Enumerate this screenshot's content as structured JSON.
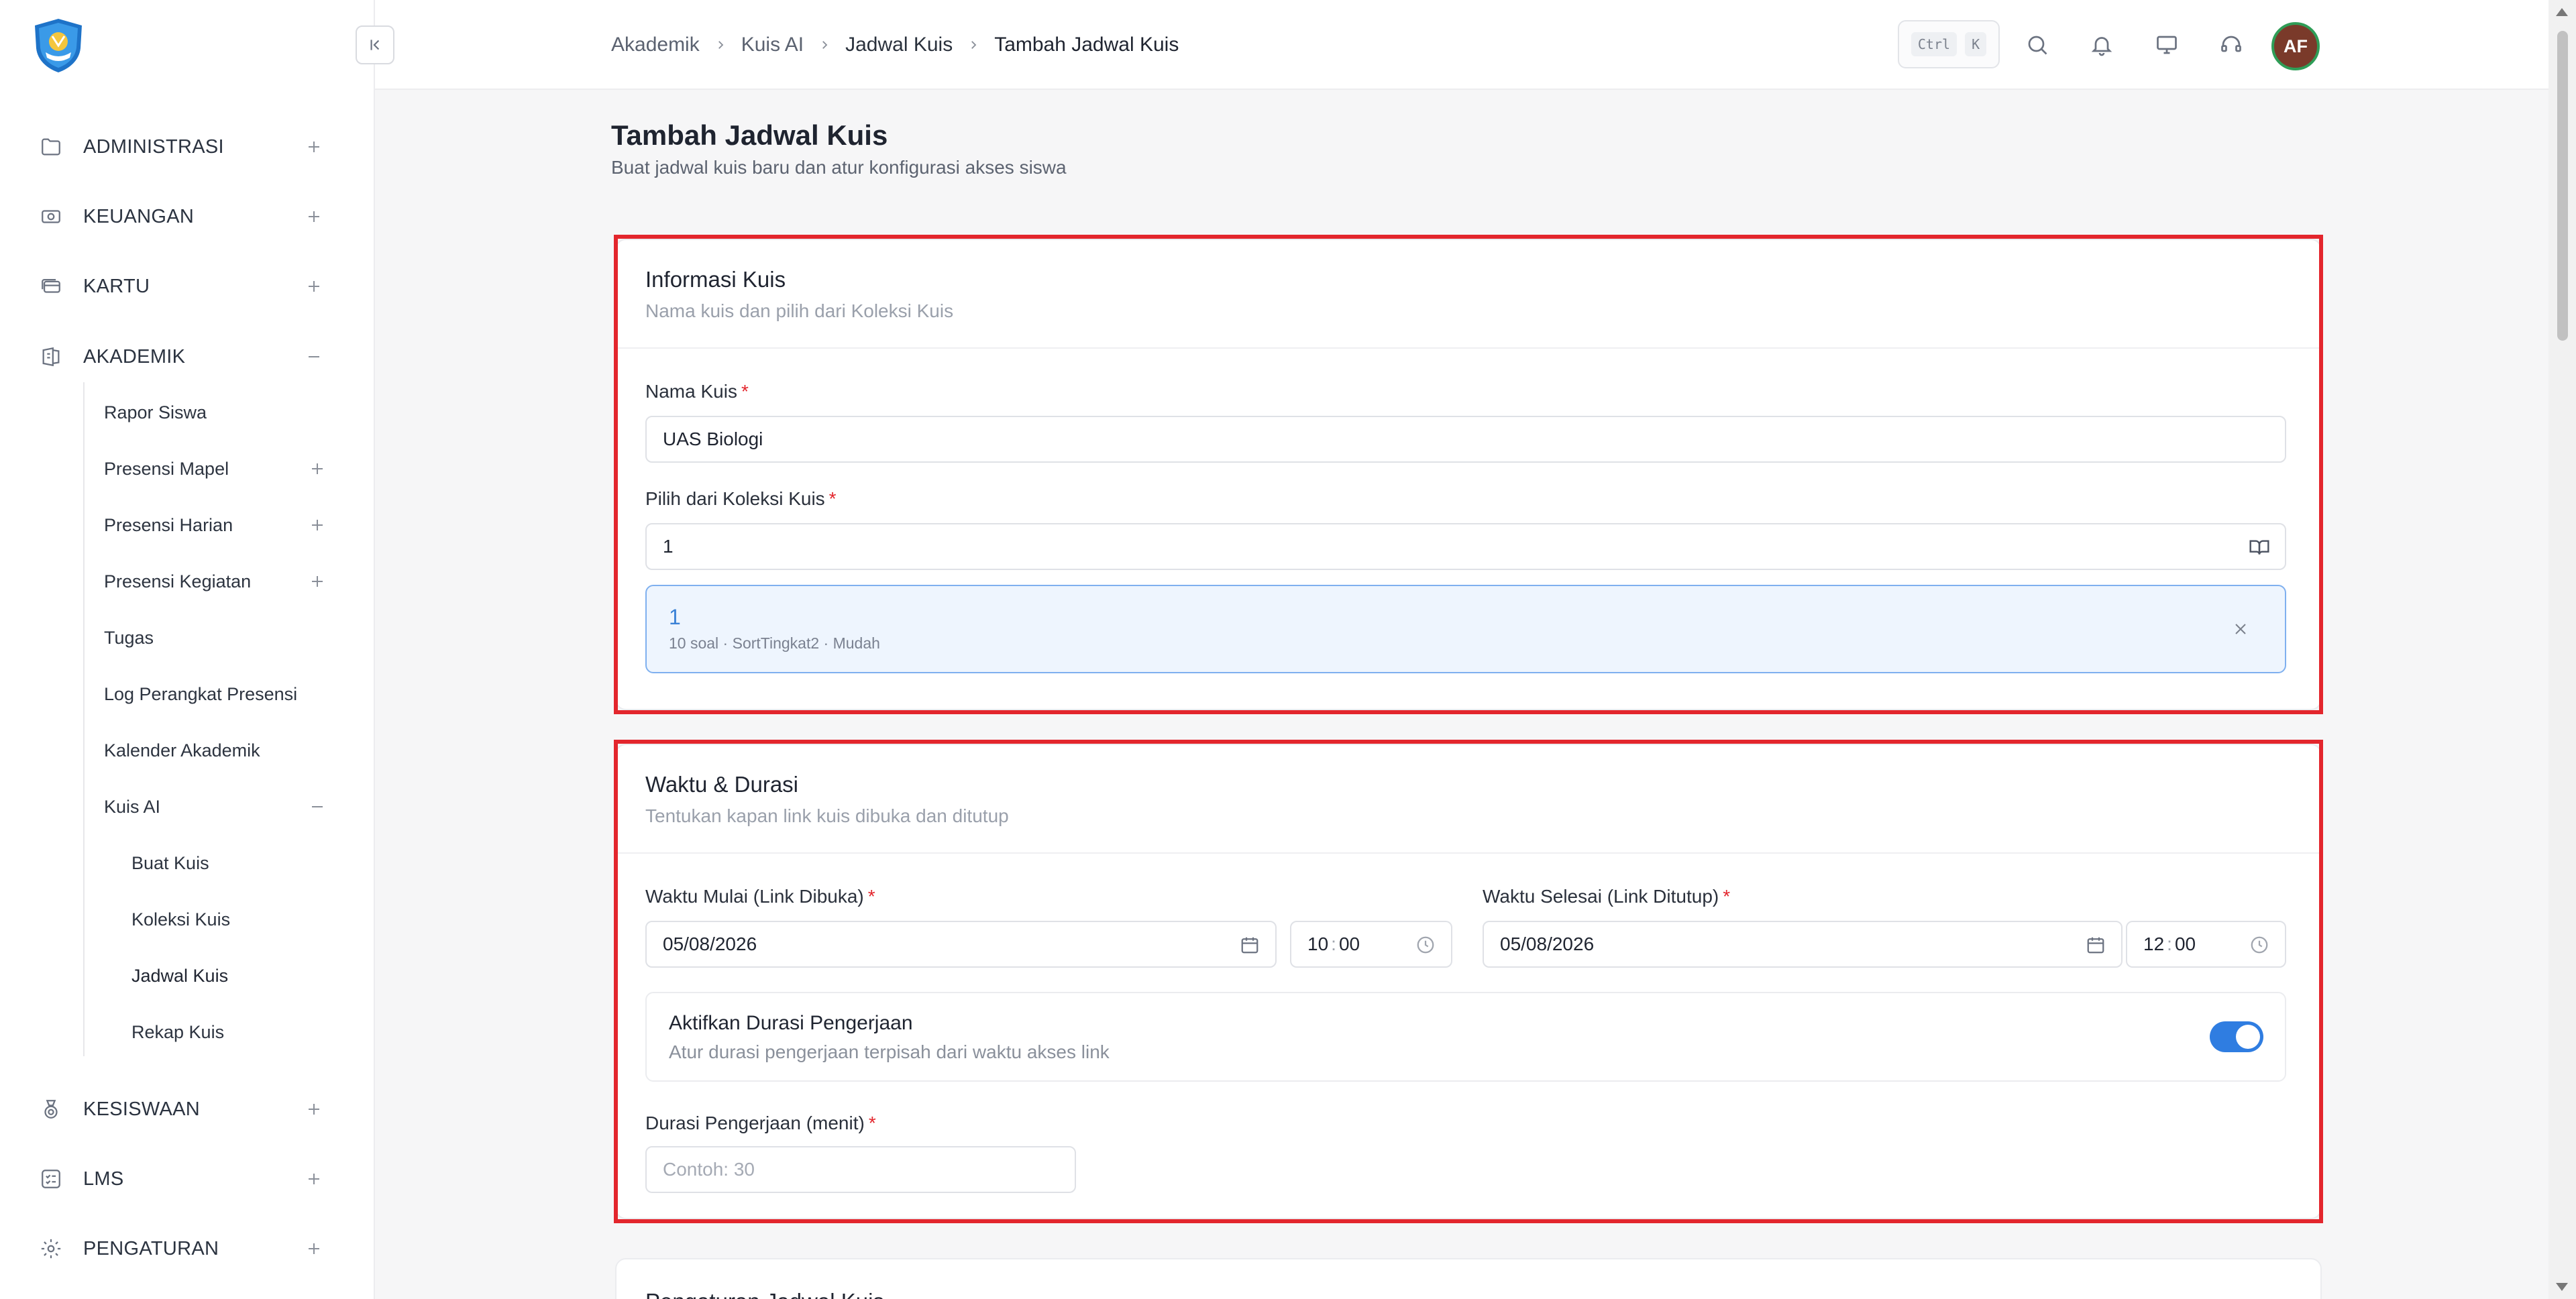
{
  "sidebar": {
    "groups": {
      "administrasi": "ADMINISTRASI",
      "keuangan": "KEUANGAN",
      "kartu": "KARTU",
      "akademik": "AKADEMIK",
      "kesiswaan": "KESISWAAN",
      "lms": "LMS",
      "pengaturan": "PENGATURAN"
    },
    "akademik_items": {
      "rapor_siswa": "Rapor Siswa",
      "presensi_mapel": "Presensi Mapel",
      "presensi_harian": "Presensi Harian",
      "presensi_kegiatan": "Presensi Kegiatan",
      "tugas": "Tugas",
      "log_perangkat": "Log Perangkat Presensi",
      "kalender": "Kalender Akademik",
      "kuis_ai": "Kuis AI"
    },
    "kuis_items": {
      "buat_kuis": "Buat Kuis",
      "koleksi_kuis": "Koleksi Kuis",
      "jadwal_kuis": "Jadwal Kuis",
      "rekap_kuis": "Rekap Kuis"
    }
  },
  "topbar": {
    "breadcrumb": [
      "Akademik",
      "Kuis AI",
      "Jadwal Kuis",
      "Tambah Jadwal Kuis"
    ],
    "kbd_ctrl": "Ctrl",
    "kbd_k": "K",
    "avatar_initials": "AF"
  },
  "page": {
    "title": "Tambah Jadwal Kuis",
    "subtitle": "Buat jadwal kuis baru dan atur konfigurasi akses siswa"
  },
  "info_card": {
    "title": "Informasi Kuis",
    "desc": "Nama kuis dan pilih dari Koleksi Kuis",
    "name_label": "Nama Kuis",
    "name_value": "UAS Biologi",
    "collection_label": "Pilih dari Koleksi Kuis",
    "collection_value": "1",
    "selected_title": "1",
    "selected_meta": "10 soal · SortTingkat2 · Mudah",
    "required_mark": "*"
  },
  "time_card": {
    "title": "Waktu & Durasi",
    "desc": "Tentukan kapan link kuis dibuka dan ditutup",
    "start_label": "Waktu Mulai (Link Dibuka)",
    "start_date": "05/08/2026",
    "start_hour": "10",
    "start_min": "00",
    "end_label": "Waktu Selesai (Link Ditutup)",
    "end_date": "05/08/2026",
    "end_hour": "12",
    "end_min": "00",
    "time_sep": ":",
    "toggle_title": "Aktifkan Durasi Pengerjaan",
    "toggle_desc": "Atur durasi pengerjaan terpisah dari waktu akses link",
    "toggle_on": true,
    "duration_label": "Durasi Pengerjaan (menit)",
    "duration_placeholder": "Contoh: 30",
    "required_mark": "*"
  },
  "next_card": {
    "title": "Pengaturan Jadwal Kuis"
  },
  "colors": {
    "accent": "#2f7de1",
    "highlight": "#e3262d",
    "required": "#e3262d",
    "selected_bg": "#eef5fe"
  }
}
